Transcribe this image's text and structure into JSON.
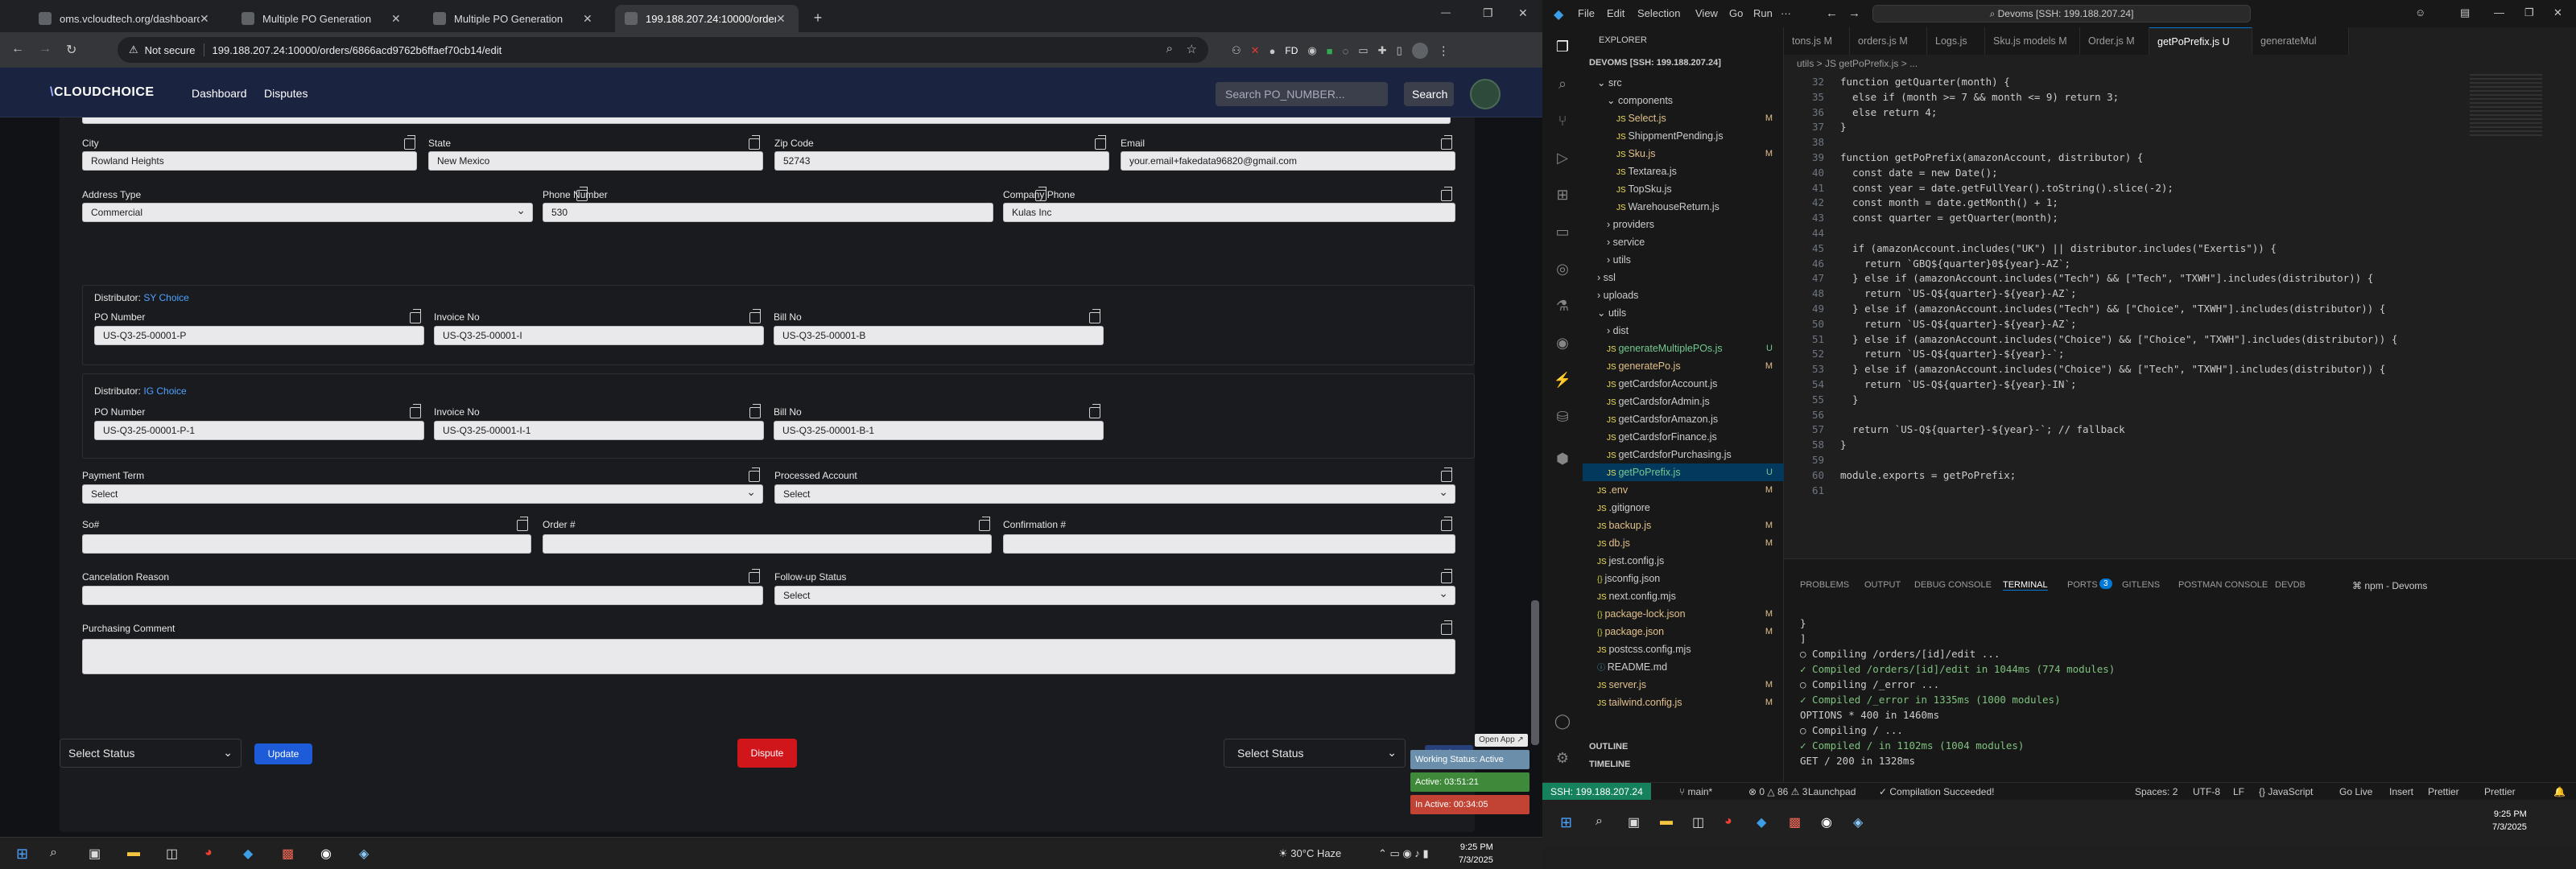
{
  "browser": {
    "tabs": [
      {
        "label": "oms.vcloudtech.org/dashboard",
        "active": false
      },
      {
        "label": "Multiple PO Generation",
        "active": false
      },
      {
        "label": "Multiple PO Generation",
        "active": false
      },
      {
        "label": "199.188.207.24:10000/orders/(",
        "active": true
      }
    ],
    "security_label": "Not secure",
    "url": "199.188.207.24:10000/orders/6866acd9762b6ffaef70cb14/edit"
  },
  "nav": {
    "logo": "CLOUDCHOICE",
    "links": [
      "Dashboard",
      "Disputes"
    ],
    "search_placeholder": "Search PO_NUMBER...",
    "search_button": "Search"
  },
  "address": {
    "city_label": "City",
    "city": "Rowland Heights",
    "state_label": "State",
    "state": "New Mexico",
    "zip_label": "Zip Code",
    "zip": "52743",
    "email_label": "Email",
    "email": "your.email+fakedata96820@gmail.com",
    "type_label": "Address Type",
    "type": "Commercial",
    "phone_label": "Phone Number",
    "phone": "530",
    "company_phone_label": "Company Phone",
    "company_phone": "Kulas Inc"
  },
  "distributors": [
    {
      "prefix": "Distributor:",
      "name": "SY Choice",
      "po_label": "PO Number",
      "po": "US-Q3-25-00001-P",
      "invoice_label": "Invoice No",
      "invoice": "US-Q3-25-00001-I",
      "bill_label": "Bill No",
      "bill": "US-Q3-25-00001-B"
    },
    {
      "prefix": "Distributor:",
      "name": "IG Choice",
      "po_label": "PO Number",
      "po": "US-Q3-25-00001-P-1",
      "invoice_label": "Invoice No",
      "invoice": "US-Q3-25-00001-I-1",
      "bill_label": "Bill No",
      "bill": "US-Q3-25-00001-B-1"
    }
  ],
  "order": {
    "payment_term_label": "Payment Term",
    "payment_term": "Select",
    "processed_account_label": "Processed Account",
    "processed_account": "Select",
    "so_label": "So#",
    "order_label": "Order #",
    "confirmation_label": "Confirmation #",
    "cancel_label": "Cancelation Reason",
    "followup_label": "Follow-up Status",
    "followup": "Select",
    "comment_label": "Purchasing Comment"
  },
  "actions": {
    "select_status": "Select Status",
    "update": "Update",
    "dispute": "Dispute",
    "select_status_2": "Select Status",
    "update_ghost": "Update"
  },
  "widget": {
    "open_app": "Open App ↗",
    "working": "Working Status: Active",
    "active": "Active: 03:51:21",
    "inactive": "In Active: 00:34:05"
  },
  "taskbar": {
    "weather": "30°C  Haze",
    "time": "9:25 PM",
    "date": "7/3/2025"
  },
  "vscode": {
    "menu": [
      "File",
      "Edit",
      "Selection",
      "View",
      "Go",
      "Run",
      "···"
    ],
    "search": "Devoms [SSH: 199.188.207.24]",
    "explorer_title": "EXPLORER",
    "workspace": "DEVOMS [SSH: 199.188.207.24]",
    "tree": [
      {
        "label": "src",
        "indent": 1,
        "kind": "folder-open",
        "mark": ""
      },
      {
        "label": "components",
        "indent": 2,
        "kind": "folder-open",
        "mark": ""
      },
      {
        "label": "Select.js",
        "indent": 3,
        "kind": "js",
        "mark": "M"
      },
      {
        "label": "ShippmentPending.js",
        "indent": 3,
        "kind": "js",
        "mark": ""
      },
      {
        "label": "Sku.js",
        "indent": 3,
        "kind": "js",
        "mark": "M"
      },
      {
        "label": "Textarea.js",
        "indent": 3,
        "kind": "js",
        "mark": ""
      },
      {
        "label": "TopSku.js",
        "indent": 3,
        "kind": "js",
        "mark": ""
      },
      {
        "label": "WarehouseReturn.js",
        "indent": 3,
        "kind": "js",
        "mark": ""
      },
      {
        "label": "providers",
        "indent": 2,
        "kind": "folder",
        "mark": ""
      },
      {
        "label": "service",
        "indent": 2,
        "kind": "folder",
        "mark": ""
      },
      {
        "label": "utils",
        "indent": 2,
        "kind": "folder",
        "mark": ""
      },
      {
        "label": "ssl",
        "indent": 1,
        "kind": "folder",
        "mark": ""
      },
      {
        "label": "uploads",
        "indent": 1,
        "kind": "folder",
        "mark": ""
      },
      {
        "label": "utils",
        "indent": 1,
        "kind": "folder-open",
        "mark": ""
      },
      {
        "label": "dist",
        "indent": 2,
        "kind": "folder",
        "mark": ""
      },
      {
        "label": "generateMultiplePOs.js",
        "indent": 2,
        "kind": "js-u",
        "mark": "U"
      },
      {
        "label": "generatePo.js",
        "indent": 2,
        "kind": "js-m",
        "mark": "M"
      },
      {
        "label": "getCardsforAccount.js",
        "indent": 2,
        "kind": "js",
        "mark": ""
      },
      {
        "label": "getCardsforAdmin.js",
        "indent": 2,
        "kind": "js",
        "mark": ""
      },
      {
        "label": "getCardsforAmazon.js",
        "indent": 2,
        "kind": "js",
        "mark": ""
      },
      {
        "label": "getCardsforFinance.js",
        "indent": 2,
        "kind": "js",
        "mark": ""
      },
      {
        "label": "getCardsforPurchasing.js",
        "indent": 2,
        "kind": "js",
        "mark": ""
      },
      {
        "label": "getPoPrefix.js",
        "indent": 2,
        "kind": "js-u-sel",
        "mark": "U"
      },
      {
        "label": ".env",
        "indent": 1,
        "kind": "file",
        "mark": "M"
      },
      {
        "label": ".gitignore",
        "indent": 1,
        "kind": "file",
        "mark": ""
      },
      {
        "label": "backup.js",
        "indent": 1,
        "kind": "js",
        "mark": "M"
      },
      {
        "label": "db.js",
        "indent": 1,
        "kind": "js",
        "mark": "M"
      },
      {
        "label": "jest.config.js",
        "indent": 1,
        "kind": "js",
        "mark": ""
      },
      {
        "label": "jsconfig.json",
        "indent": 1,
        "kind": "json",
        "mark": ""
      },
      {
        "label": "next.config.mjs",
        "indent": 1,
        "kind": "js",
        "mark": ""
      },
      {
        "label": "package-lock.json",
        "indent": 1,
        "kind": "json",
        "mark": "M"
      },
      {
        "label": "package.json",
        "indent": 1,
        "kind": "json",
        "mark": "M"
      },
      {
        "label": "postcss.config.mjs",
        "indent": 1,
        "kind": "js",
        "mark": ""
      },
      {
        "label": "README.md",
        "indent": 1,
        "kind": "md",
        "mark": ""
      },
      {
        "label": "server.js",
        "indent": 1,
        "kind": "js",
        "mark": "M"
      },
      {
        "label": "tailwind.config.js",
        "indent": 1,
        "kind": "js",
        "mark": "M"
      }
    ],
    "outline": "OUTLINE",
    "timeline": "TIMELINE",
    "tabs": [
      "tons.js M",
      "orders.js M",
      "Logs.js",
      "Sku.js models M",
      "Order.js M",
      "getPoPrefix.js U",
      "generateMul"
    ],
    "breadcrumb": "utils > JS getPoPrefix.js > ...",
    "code": [
      {
        "n": "32",
        "t": "function getQuarter(month) {"
      },
      {
        "n": "35",
        "t": "  else if (month >= 7 && month <= 9) return 3;"
      },
      {
        "n": "36",
        "t": "  else return 4;"
      },
      {
        "n": "37",
        "t": "}"
      },
      {
        "n": "38",
        "t": ""
      },
      {
        "n": "39",
        "t": "function getPoPrefix(amazonAccount, distributor) {"
      },
      {
        "n": "40",
        "t": "  const date = new Date();"
      },
      {
        "n": "41",
        "t": "  const year = date.getFullYear().toString().slice(-2);"
      },
      {
        "n": "42",
        "t": "  const month = date.getMonth() + 1;"
      },
      {
        "n": "43",
        "t": "  const quarter = getQuarter(month);"
      },
      {
        "n": "44",
        "t": ""
      },
      {
        "n": "45",
        "t": "  if (amazonAccount.includes(\"UK\") || distributor.includes(\"Exertis\")) {"
      },
      {
        "n": "46",
        "t": "    return `GBQ${quarter}0${year}-AZ`;"
      },
      {
        "n": "47",
        "t": "  } else if (amazonAccount.includes(\"Tech\") && [\"Tech\", \"TXWH\"].includes(distributor)) {"
      },
      {
        "n": "48",
        "t": "    return `US-Q${quarter}-${year}-AZ`;"
      },
      {
        "n": "49",
        "t": "  } else if (amazonAccount.includes(\"Tech\") && [\"Choice\", \"TXWH\"].includes(distributor)) {"
      },
      {
        "n": "50",
        "t": "    return `US-Q${quarter}-${year}-AZ`;"
      },
      {
        "n": "51",
        "t": "  } else if (amazonAccount.includes(\"Choice\") && [\"Choice\", \"TXWH\"].includes(distributor)) {"
      },
      {
        "n": "52",
        "t": "    return `US-Q${quarter}-${year}-`;"
      },
      {
        "n": "53",
        "t": "  } else if (amazonAccount.includes(\"Choice\") && [\"Tech\", \"TXWH\"].includes(distributor)) {"
      },
      {
        "n": "54",
        "t": "    return `US-Q${quarter}-${year}-IN`;"
      },
      {
        "n": "55",
        "t": "  }"
      },
      {
        "n": "56",
        "t": ""
      },
      {
        "n": "57",
        "t": "  return `US-Q${quarter}-${year}-`; // fallback"
      },
      {
        "n": "58",
        "t": "}"
      },
      {
        "n": "59",
        "t": ""
      },
      {
        "n": "60",
        "t": "module.exports = getPoPrefix;"
      },
      {
        "n": "61",
        "t": ""
      }
    ],
    "panel_tabs": [
      "PROBLEMS",
      "OUTPUT",
      "DEBUG CONSOLE",
      "TERMINAL",
      "PORTS",
      "GITLENS",
      "POSTMAN CONSOLE",
      "DEVDB"
    ],
    "ports_badge": "3",
    "terminal_label": "npm - Devoms",
    "terminal": [
      "}",
      "]",
      "○ Compiling /orders/[id]/edit ...",
      "✓ Compiled /orders/[id]/edit in 1044ms (774 modules)",
      "○ Compiling /_error ...",
      "✓ Compiled /_error in 1335ms (1000 modules)",
      "OPTIONS * 400 in 1460ms",
      "○ Compiling / ...",
      "✓ Compiled / in 1102ms (1004 modules)",
      "GET / 200 in 1328ms"
    ],
    "status": {
      "remote": "SSH: 199.188.207.24",
      "branch": "main*",
      "problems": "⊗ 0 △ 86 ⚠ 3",
      "compile": "Compilation Succeeded!",
      "launchpad": "Launchpad",
      "spaces": "Spaces: 2",
      "encoding": "UTF-8",
      "eol": "LF",
      "lang": "{} JavaScript",
      "golive": "Go Live",
      "insert": "Insert",
      "prettier": "Prettier",
      "prettier2": "Prettier"
    }
  }
}
